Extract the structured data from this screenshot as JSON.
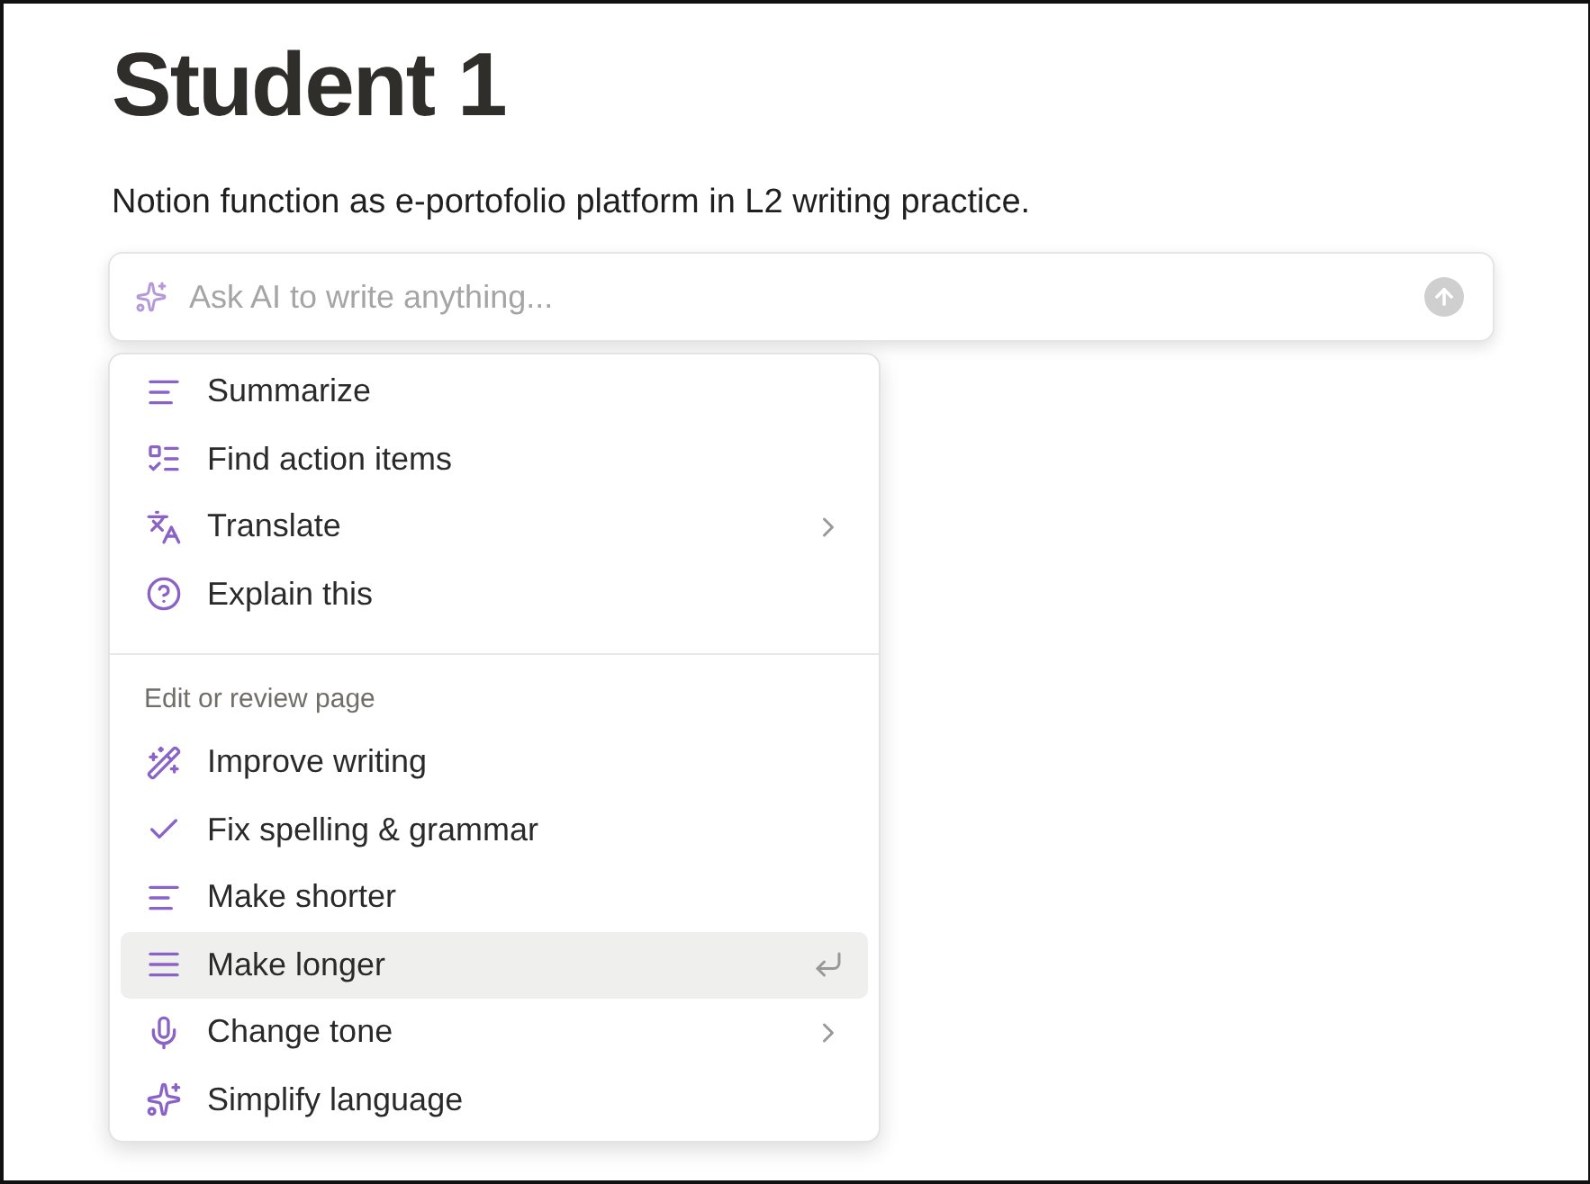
{
  "page": {
    "title": "Student 1",
    "description": "Notion function as e-portofolio platform in L2 writing practice."
  },
  "ai_prompt": {
    "placeholder": "Ask AI to write anything..."
  },
  "menu": {
    "sections": [
      {
        "items": [
          {
            "label": "Summarize",
            "submenu": false,
            "selected": false
          },
          {
            "label": "Find action items",
            "submenu": false,
            "selected": false
          },
          {
            "label": "Translate",
            "submenu": true,
            "selected": false
          },
          {
            "label": "Explain this",
            "submenu": false,
            "selected": false
          }
        ]
      },
      {
        "heading": "Edit or review page",
        "items": [
          {
            "label": "Improve writing",
            "submenu": false,
            "selected": false
          },
          {
            "label": "Fix spelling & grammar",
            "submenu": false,
            "selected": false
          },
          {
            "label": "Make shorter",
            "submenu": false,
            "selected": false
          },
          {
            "label": "Make longer",
            "submenu": false,
            "selected": true
          },
          {
            "label": "Change tone",
            "submenu": true,
            "selected": false
          },
          {
            "label": "Simplify language",
            "submenu": false,
            "selected": false
          }
        ]
      }
    ]
  }
}
